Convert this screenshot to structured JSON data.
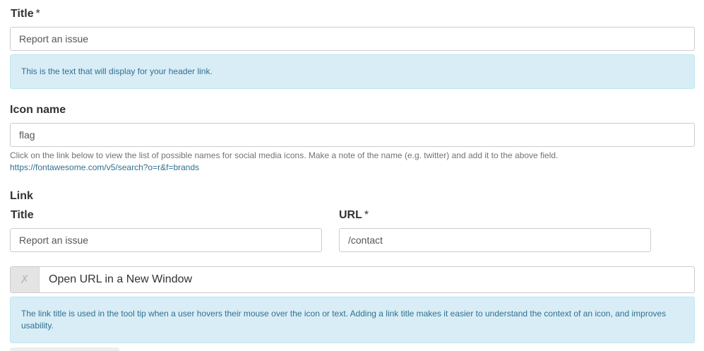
{
  "title_field": {
    "label": "Title",
    "required_mark": "*",
    "value": "Report an issue",
    "info": "This is the text that will display for your header link."
  },
  "icon_field": {
    "label": "Icon name",
    "value": "flag",
    "help": "Click on the link below to view the list of possible names for social media icons. Make a note of the name (e.g. twitter) and add it to the above field.",
    "link": "https://fontawesome.com/v5/search?o=r&f=brands"
  },
  "link_section": {
    "label": "Link",
    "title_label": "Title",
    "title_value": "Report an issue",
    "url_label": "URL",
    "url_required_mark": "*",
    "url_value": "/contact"
  },
  "new_window": {
    "toggle_glyph": "✗",
    "label": "Open URL in a New Window",
    "checked": false
  },
  "link_info": "The link title is used in the tool tip when a user hovers their mouse over the icon or text. Adding a link title makes it easier to understand the context of an icon, and improves usability."
}
